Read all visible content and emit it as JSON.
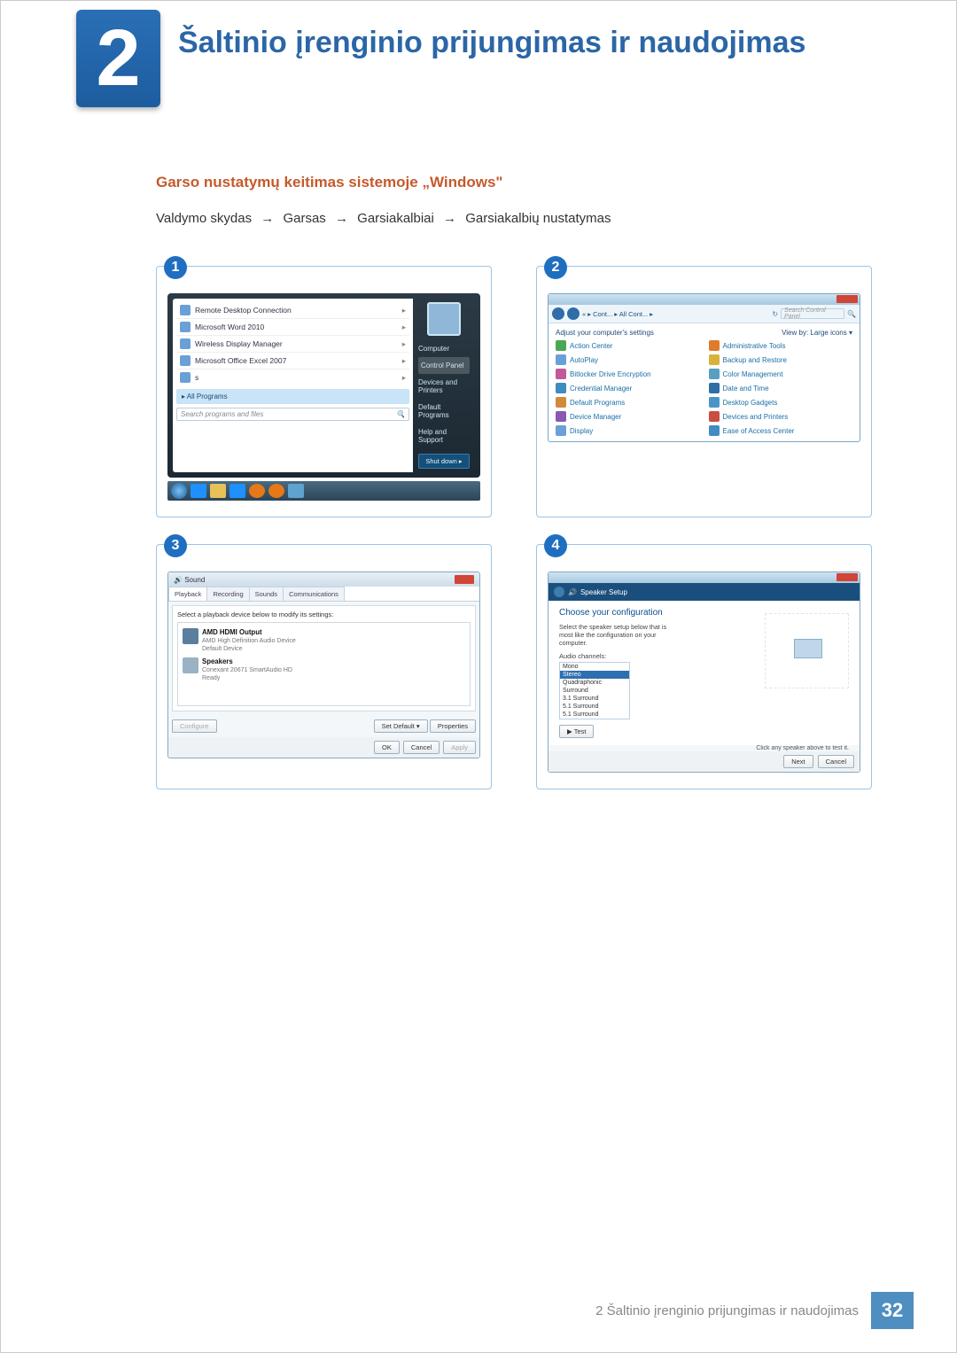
{
  "chapter": {
    "number": "2",
    "title": "Šaltinio įrenginio prijungimas ir naudojimas"
  },
  "section_heading": "Garso nustatymų keitimas sistemoje „Windows\"",
  "nav_path": {
    "a": "Valdymo skydas",
    "b": "Garsas",
    "c": "Garsiakalbiai",
    "d": "Garsiakalbių nustatymas",
    "arrow": "→"
  },
  "step1": {
    "num": "1",
    "items": [
      "Remote Desktop Connection",
      "Microsoft Word 2010",
      "Wireless Display Manager",
      "Microsoft Office Excel 2007",
      "s"
    ],
    "all_programs": "All Programs",
    "search_placeholder": "Search programs and files",
    "right": [
      "Computer",
      "Control Panel",
      "Devices and Printers",
      "Default Programs",
      "Help and Support"
    ],
    "shutdown": "Shut down"
  },
  "step2": {
    "num": "2",
    "path": "« ▸ Cont... ▸ All Cont... ▸",
    "search_ph": "Search Control Panel",
    "header_left": "Adjust your computer's settings",
    "header_right": "View by:  Large icons ▾",
    "items_left": [
      "Action Center",
      "AutoPlay",
      "Bitlocker Drive Encryption",
      "Credential Manager",
      "Default Programs",
      "Device Manager",
      "Display"
    ],
    "items_right": [
      "Administrative Tools",
      "Backup and Restore",
      "Color Management",
      "Date and Time",
      "Desktop Gadgets",
      "Devices and Printers",
      "Ease of Access Center"
    ]
  },
  "step3": {
    "num": "3",
    "title": "Sound",
    "tabs": [
      "Playback",
      "Recording",
      "Sounds",
      "Communications"
    ],
    "instruction": "Select a playback device below to modify its settings:",
    "dev1": {
      "name": "AMD HDMI Output",
      "sub1": "AMD High Definition Audio Device",
      "sub2": "Default Device"
    },
    "dev2": {
      "name": "Speakers",
      "sub1": "Conexant 20671 SmartAudio HD",
      "sub2": "Ready"
    },
    "btn_configure": "Configure",
    "btn_setdefault": "Set Default ▾",
    "btn_properties": "Properties",
    "btn_ok": "OK",
    "btn_cancel": "Cancel",
    "btn_apply": "Apply"
  },
  "step4": {
    "num": "4",
    "title": "Speaker Setup",
    "conf": "Choose your configuration",
    "instr": "Select the speaker setup below that is most like the configuration on your computer.",
    "channels_label": "Audio channels:",
    "options": [
      "Mono",
      "Stereo",
      "Quadraphonic",
      "Surround",
      "3.1 Surround",
      "5.1 Surround",
      "5.1 Surround"
    ],
    "selected_index": 1,
    "btn_test": "Test",
    "hint": "Click any speaker above to test it.",
    "btn_next": "Next",
    "btn_cancel": "Cancel"
  },
  "footer": {
    "text": "2 Šaltinio įrenginio prijungimas ir naudojimas",
    "page": "32"
  },
  "icon_colors": {
    "cp": [
      "#4aa854",
      "#e07a2c",
      "#6aa0d8",
      "#d9b23a",
      "#c05a9a",
      "#5a9ec0",
      "#3f8cc1",
      "#2f6fa6",
      "#d08a3a",
      "#4a94c7",
      "#8a5ab0",
      "#c84e3f",
      "#6aa0d8",
      "#3f8cc1"
    ]
  }
}
